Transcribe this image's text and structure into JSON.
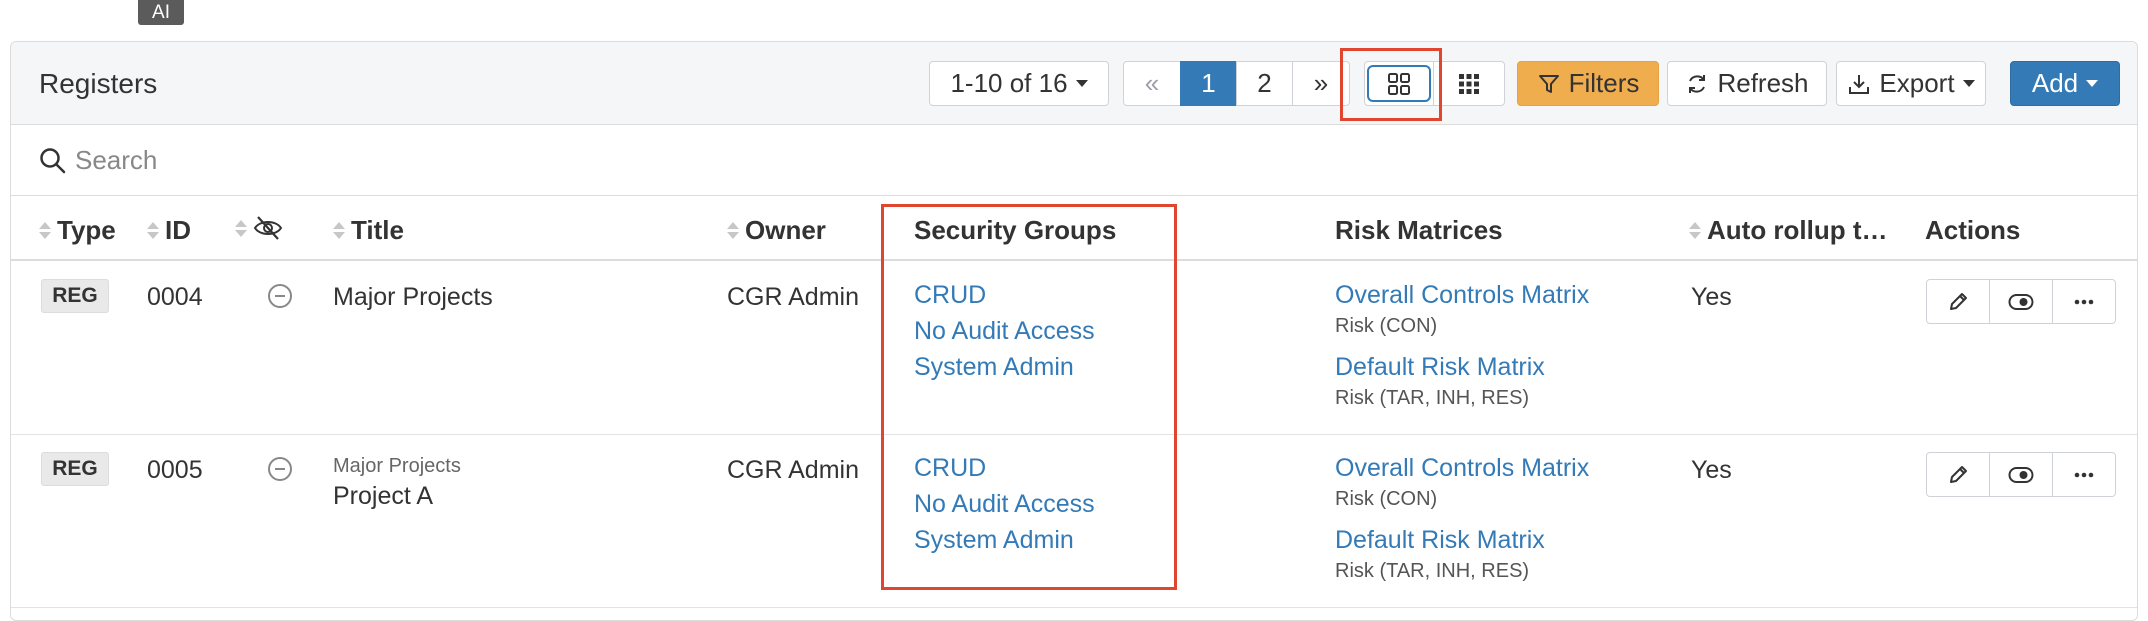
{
  "ai_tag": "AI",
  "panel": {
    "title": "Registers"
  },
  "toolbar": {
    "range_label": "1-10 of 16",
    "pages": [
      "1",
      "2"
    ],
    "prev_symbol": "«",
    "next_symbol": "»",
    "filters_label": "Filters",
    "refresh_label": "Refresh",
    "export_label": "Export",
    "add_label": "Add"
  },
  "search": {
    "placeholder": "Search"
  },
  "columns": {
    "type": "Type",
    "id": "ID",
    "title": "Title",
    "owner": "Owner",
    "security_groups": "Security Groups",
    "risk_matrices": "Risk Matrices",
    "auto_rollup": "Auto rollup t…",
    "actions": "Actions"
  },
  "rows": [
    {
      "type": "REG",
      "id": "0004",
      "parent": "",
      "title": "Major Projects",
      "owner": "CGR Admin",
      "security_groups": [
        "CRUD",
        "No Audit Access",
        "System Admin"
      ],
      "risk_matrices": [
        {
          "name": "Overall Controls Matrix",
          "detail": "Risk (CON)"
        },
        {
          "name": "Default Risk Matrix",
          "detail": "Risk (TAR, INH, RES)"
        }
      ],
      "auto_rollup": "Yes"
    },
    {
      "type": "REG",
      "id": "0005",
      "parent": "Major Projects",
      "title": "Project A",
      "owner": "CGR Admin",
      "security_groups": [
        "CRUD",
        "No Audit Access",
        "System Admin"
      ],
      "risk_matrices": [
        {
          "name": "Overall Controls Matrix",
          "detail": "Risk (CON)"
        },
        {
          "name": "Default Risk Matrix",
          "detail": "Risk (TAR, INH, RES)"
        }
      ],
      "auto_rollup": "Yes"
    }
  ],
  "colors": {
    "primary": "#337ab7",
    "warning": "#f0ad4e",
    "highlight": "#e0452f",
    "header_bg": "#f5f6f7"
  }
}
